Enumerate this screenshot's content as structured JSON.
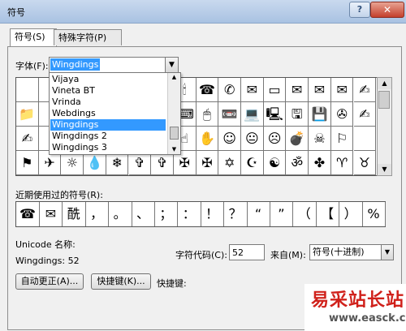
{
  "window": {
    "title": "符号",
    "help_label": "?",
    "close_label": "✕"
  },
  "tabs": [
    {
      "label": "符号(S)"
    },
    {
      "label": "特殊字符(P)"
    }
  ],
  "font": {
    "label": "字体(F):",
    "value": "Wingdings",
    "dropdown_arrow": "▼"
  },
  "font_dropdown": {
    "items": [
      {
        "label": "Vijaya"
      },
      {
        "label": "Vineta BT"
      },
      {
        "label": "Vrinda"
      },
      {
        "label": "Webdings"
      },
      {
        "label": "Wingdings"
      },
      {
        "label": "Wingdings 2"
      },
      {
        "label": "Wingdings 3"
      }
    ],
    "selected_index": 4
  },
  "symbol_grid": {
    "rows": [
      [
        "",
        "",
        "",
        "",
        "",
        "",
        "",
        "🕯",
        "☎",
        "✆",
        "✉",
        "▭",
        "✉",
        "✉",
        "✉",
        "✍"
      ],
      [
        "📁",
        "",
        "",
        "",
        "",
        "",
        "",
        "⌨",
        "🖱",
        "📼",
        "💻",
        "🖳",
        "🖫",
        "💾",
        "✇",
        "✍"
      ],
      [
        "✍",
        "",
        "",
        "",
        "",
        "",
        "",
        "☝",
        "✋",
        "☺",
        "😐",
        "☹",
        "💣",
        "☠",
        "⚐"
      ],
      [
        "⚑",
        "✈",
        "☼",
        "💧",
        "❄",
        "✞",
        "✞",
        "✠",
        "✠",
        "✡",
        "☪",
        "☯",
        "ॐ",
        "✤",
        "♈",
        "♉"
      ]
    ]
  },
  "recent": {
    "label": "近期使用过的符号(R):",
    "symbols": [
      "☎",
      "✉",
      "酰",
      "，",
      "。",
      "、",
      "；",
      "：",
      "！",
      "？",
      "“",
      "”",
      "（",
      "【",
      "）",
      "%"
    ]
  },
  "unicode": {
    "name_label": "Unicode 名称:",
    "name_value": "Wingdings: 52"
  },
  "char_code": {
    "label": "字符代码(C):",
    "value": "52"
  },
  "from": {
    "label": "来自(M):",
    "value": "符号(十进制)"
  },
  "buttons": {
    "autocorrect": "自动更正(A)...",
    "shortcut_key": "快捷键(K)...",
    "shortcut_label": "快捷键:"
  },
  "watermark": {
    "text": "易采站长站",
    "url": "www.easck.com"
  }
}
